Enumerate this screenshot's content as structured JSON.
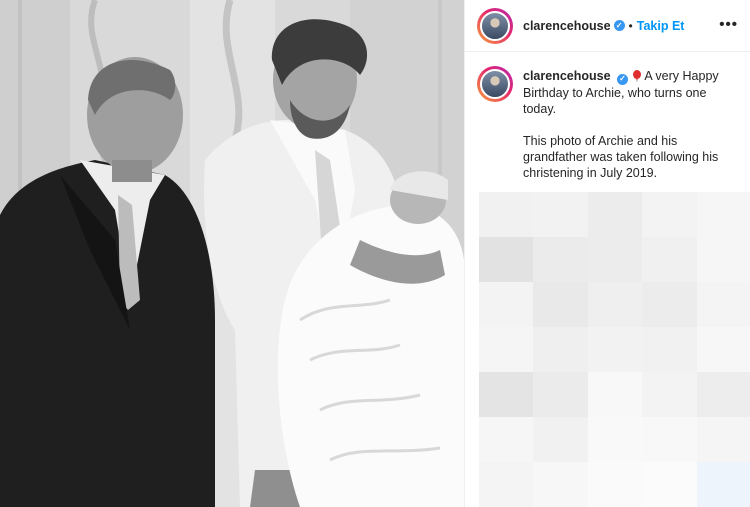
{
  "post": {
    "username": "clarencehouse",
    "separator": "•",
    "follow_label": "Takip Et",
    "more_label": "•••",
    "caption_line1": "A very Happy Birthday to Archie, who turns one today.",
    "caption_line2": "This photo of Archie and his grandfather was taken following his christening in July 2019."
  },
  "icons": {
    "verified": "verified-badge-icon",
    "balloon": "balloon-emoji-icon",
    "more": "more-options-icon"
  },
  "colors": {
    "follow": "#0095f6",
    "verified": "#3897f0",
    "ring_start": "#f9a13a",
    "ring_end": "#b52ab5"
  },
  "blur_tiles": [
    "#f1f1f1",
    "#f2f2f2",
    "#ececec",
    "#f3f3f3",
    "#f6f6f6",
    "#e2e2e2",
    "#ebebeb",
    "#ececec",
    "#f0f0f0",
    "#f6f6f6",
    "#f3f3f3",
    "#e9e9e9",
    "#efefef",
    "#ececec",
    "#f4f4f4",
    "#f5f5f5",
    "#efefef",
    "#f2f2f2",
    "#f1f1f1",
    "#f7f7f7",
    "#e4e4e4",
    "#ebebeb",
    "#f8f8f8",
    "#f3f3f3",
    "#ededed",
    "#f6f6f6",
    "#f1f1f1",
    "#f9f9f9",
    "#f8f8f8",
    "#f5f5f5",
    "#f4f4f4",
    "#f7f7f7",
    "#fafafa",
    "#fbfbfb",
    "#eef4fb"
  ]
}
